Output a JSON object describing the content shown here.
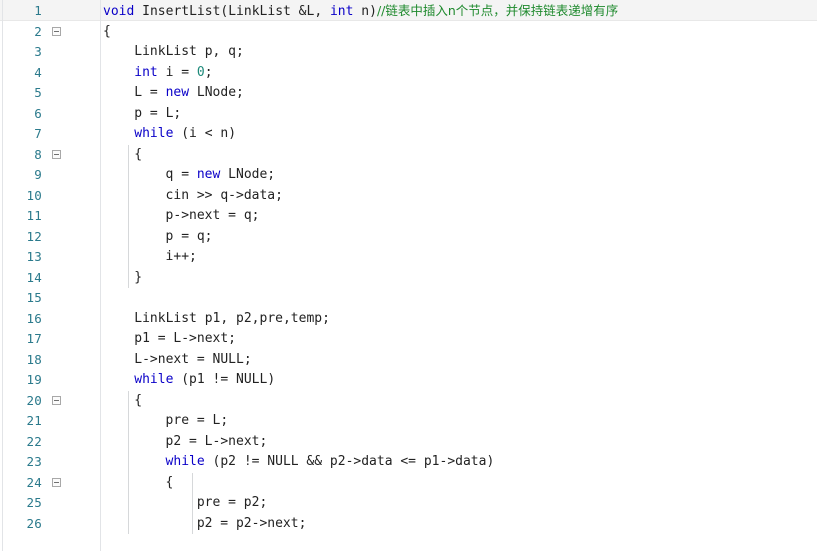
{
  "editor": {
    "language": "C++",
    "theme": "light",
    "font_size_px": 13,
    "line_height_px": 20.5,
    "colors": {
      "background": "#ffffff",
      "text": "#222222",
      "keyword": "#0a00c8",
      "number": "#1d8a7a",
      "comment": "#1f8a2e",
      "line_number": "#2b7a8c",
      "gutter_rule": "#e2e4e7",
      "indent_guide": "#d6d8da",
      "current_line": "#f4f4f4"
    },
    "current_line": 1,
    "first_visible_line": 1,
    "last_visible_line": 26
  },
  "gutter": {
    "line_numbers": [
      1,
      2,
      3,
      4,
      5,
      6,
      7,
      8,
      9,
      10,
      11,
      12,
      13,
      14,
      15,
      16,
      17,
      18,
      19,
      20,
      21,
      22,
      23,
      24,
      25,
      26
    ],
    "fold_markers": [
      {
        "line": 2,
        "state": "expanded",
        "glyph": "minus-square"
      },
      {
        "line": 8,
        "state": "expanded",
        "glyph": "minus-square"
      },
      {
        "line": 20,
        "state": "expanded",
        "glyph": "minus-square"
      },
      {
        "line": 24,
        "state": "expanded",
        "glyph": "minus-square"
      }
    ]
  },
  "code": {
    "lines": [
      {
        "number": 1,
        "indent": 0,
        "tokens": [
          {
            "t": "void",
            "c": "kw"
          },
          {
            "t": " InsertList(LinkList &L, ",
            "c": "plain"
          },
          {
            "t": "int",
            "c": "kw"
          },
          {
            "t": " n)",
            "c": "plain"
          },
          {
            "t": "//链表中插入n个节点，并保持链表递增有序",
            "c": "comment"
          }
        ]
      },
      {
        "number": 2,
        "indent": 0,
        "tokens": [
          {
            "t": "{",
            "c": "plain"
          }
        ]
      },
      {
        "number": 3,
        "indent": 1,
        "tokens": [
          {
            "t": "LinkList p, q;",
            "c": "plain"
          }
        ]
      },
      {
        "number": 4,
        "indent": 1,
        "tokens": [
          {
            "t": "int",
            "c": "kw"
          },
          {
            "t": " i = ",
            "c": "plain"
          },
          {
            "t": "0",
            "c": "num"
          },
          {
            "t": ";",
            "c": "plain"
          }
        ]
      },
      {
        "number": 5,
        "indent": 1,
        "tokens": [
          {
            "t": "L = ",
            "c": "plain"
          },
          {
            "t": "new",
            "c": "kw"
          },
          {
            "t": " LNode;",
            "c": "plain"
          }
        ]
      },
      {
        "number": 6,
        "indent": 1,
        "tokens": [
          {
            "t": "p = L;",
            "c": "plain"
          }
        ]
      },
      {
        "number": 7,
        "indent": 1,
        "tokens": [
          {
            "t": "while",
            "c": "kw"
          },
          {
            "t": " (i < n)",
            "c": "plain"
          }
        ]
      },
      {
        "number": 8,
        "indent": 1,
        "tokens": [
          {
            "t": "{",
            "c": "plain"
          }
        ]
      },
      {
        "number": 9,
        "indent": 2,
        "tokens": [
          {
            "t": "q = ",
            "c": "plain"
          },
          {
            "t": "new",
            "c": "kw"
          },
          {
            "t": " LNode;",
            "c": "plain"
          }
        ]
      },
      {
        "number": 10,
        "indent": 2,
        "tokens": [
          {
            "t": "cin >> q->data;",
            "c": "plain"
          }
        ]
      },
      {
        "number": 11,
        "indent": 2,
        "tokens": [
          {
            "t": "p->next = q;",
            "c": "plain"
          }
        ]
      },
      {
        "number": 12,
        "indent": 2,
        "tokens": [
          {
            "t": "p = q;",
            "c": "plain"
          }
        ]
      },
      {
        "number": 13,
        "indent": 2,
        "tokens": [
          {
            "t": "i++;",
            "c": "plain"
          }
        ]
      },
      {
        "number": 14,
        "indent": 1,
        "tokens": [
          {
            "t": "}",
            "c": "plain"
          }
        ]
      },
      {
        "number": 15,
        "indent": 0,
        "tokens": [
          {
            "t": "",
            "c": "plain"
          }
        ]
      },
      {
        "number": 16,
        "indent": 1,
        "tokens": [
          {
            "t": "LinkList p1, p2,pre,temp;",
            "c": "plain"
          }
        ]
      },
      {
        "number": 17,
        "indent": 1,
        "tokens": [
          {
            "t": "p1 = L->next;",
            "c": "plain"
          }
        ]
      },
      {
        "number": 18,
        "indent": 1,
        "tokens": [
          {
            "t": "L->next = NULL;",
            "c": "plain"
          }
        ]
      },
      {
        "number": 19,
        "indent": 1,
        "tokens": [
          {
            "t": "while",
            "c": "kw"
          },
          {
            "t": " (p1 != NULL)",
            "c": "plain"
          }
        ]
      },
      {
        "number": 20,
        "indent": 1,
        "tokens": [
          {
            "t": "{",
            "c": "plain"
          }
        ]
      },
      {
        "number": 21,
        "indent": 2,
        "tokens": [
          {
            "t": "pre = L;",
            "c": "plain"
          }
        ]
      },
      {
        "number": 22,
        "indent": 2,
        "tokens": [
          {
            "t": "p2 = L->next;",
            "c": "plain"
          }
        ]
      },
      {
        "number": 23,
        "indent": 2,
        "tokens": [
          {
            "t": "while",
            "c": "kw"
          },
          {
            "t": " (p2 != NULL && p2->data <= p1->data)",
            "c": "plain"
          }
        ]
      },
      {
        "number": 24,
        "indent": 2,
        "tokens": [
          {
            "t": "{",
            "c": "plain"
          }
        ]
      },
      {
        "number": 25,
        "indent": 3,
        "tokens": [
          {
            "t": "pre = p2;",
            "c": "plain"
          }
        ]
      },
      {
        "number": 26,
        "indent": 3,
        "tokens": [
          {
            "t": "p2 = p2->next;",
            "c": "plain"
          }
        ]
      }
    ]
  },
  "indent_guides": [
    {
      "level": 1,
      "x": -6,
      "from_line": 8,
      "to_line": 14
    },
    {
      "level": 1,
      "x": -6,
      "from_line": 20,
      "to_line": 26
    },
    {
      "level": 2,
      "x": 26,
      "from_line": 24,
      "to_line": 26
    }
  ]
}
